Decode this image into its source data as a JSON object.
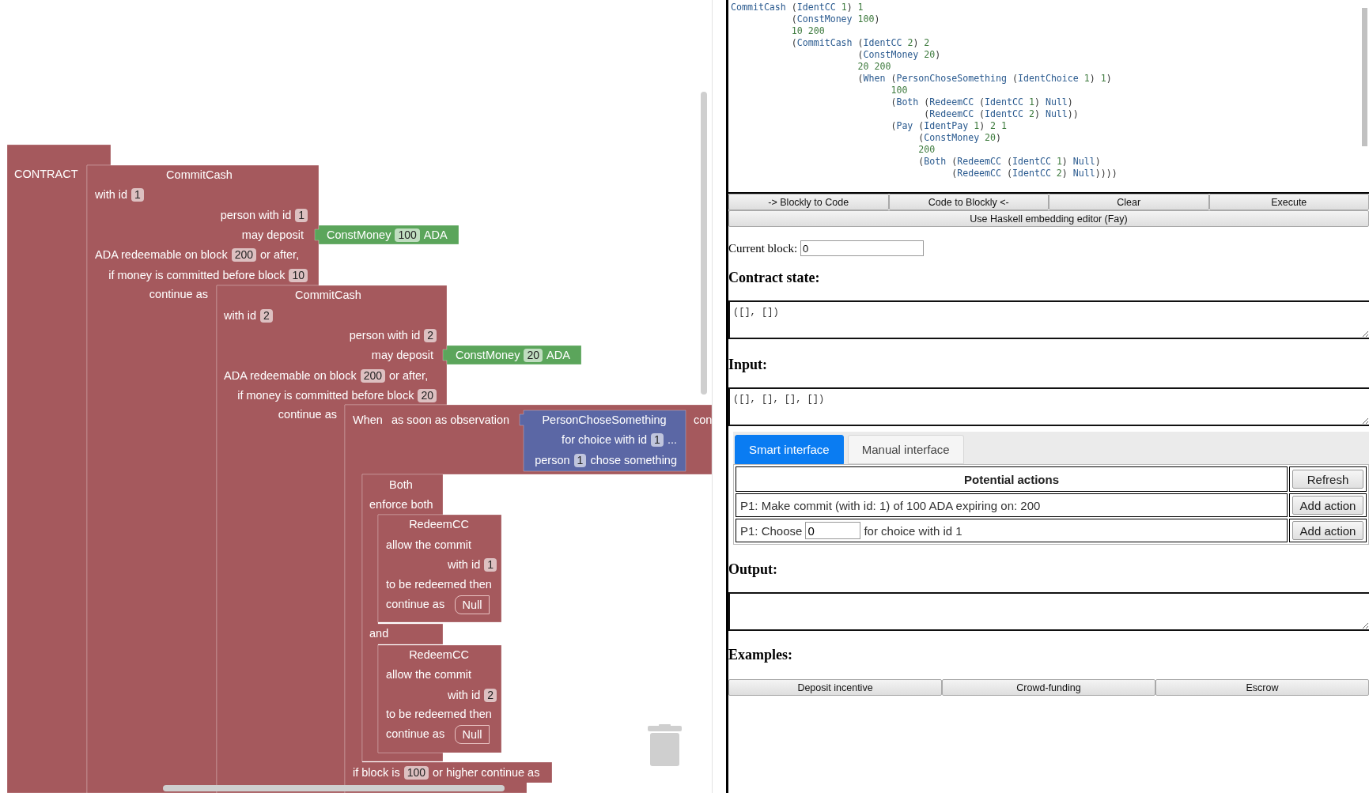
{
  "workspace": {
    "blocks": [
      {
        "kind": "contract",
        "lines": [
          [
            "CONTRACT"
          ]
        ]
      },
      {
        "kind": "statement",
        "lines": [
          [
            "CommitCash"
          ],
          [
            "with id",
            {
              "field": "1"
            }
          ],
          [
            "person with id",
            {
              "field": "1"
            }
          ],
          [
            "may deposit"
          ],
          [
            "ADA redeemable on block",
            {
              "field": "200"
            },
            "or after,"
          ],
          [
            "if money is committed before block",
            {
              "field": "10"
            }
          ],
          [
            "continue as"
          ]
        ]
      },
      {
        "kind": "value",
        "lines": [
          [
            "ConstMoney",
            {
              "field": "100"
            },
            "ADA"
          ]
        ]
      },
      {
        "kind": "statement",
        "lines": [
          [
            "CommitCash"
          ],
          [
            "with id",
            {
              "field": "2"
            }
          ],
          [
            "person with id",
            {
              "field": "2"
            }
          ],
          [
            "may deposit"
          ],
          [
            "ADA redeemable on block",
            {
              "field": "200"
            },
            "or after,"
          ],
          [
            "if money is committed before block",
            {
              "field": "20"
            }
          ],
          [
            "continue as"
          ]
        ]
      },
      {
        "kind": "value",
        "lines": [
          [
            "ConstMoney",
            {
              "field": "20"
            },
            "ADA"
          ]
        ]
      },
      {
        "kind": "statement",
        "lines": [
          [
            "When"
          ],
          [
            "as soon as observation"
          ],
          [
            "con"
          ],
          [
            "if block is",
            {
              "field": "100"
            },
            "or higher continue as"
          ]
        ]
      },
      {
        "kind": "observation",
        "lines": [
          [
            "PersonChoseSomething"
          ],
          [
            "for choice with id",
            {
              "field": "1"
            },
            "..."
          ],
          [
            "person",
            {
              "field": "1"
            },
            "chose something"
          ]
        ]
      },
      {
        "kind": "statement",
        "lines": [
          [
            "Both"
          ],
          [
            "enforce both"
          ],
          [
            "and"
          ]
        ]
      },
      {
        "kind": "statement",
        "lines": [
          [
            "RedeemCC"
          ],
          [
            "allow the commit"
          ],
          [
            "with id",
            {
              "field": "1"
            }
          ],
          [
            "to be redeemed then"
          ],
          [
            "continue as"
          ]
        ]
      },
      {
        "kind": "terminal",
        "lines": [
          [
            "Null"
          ]
        ]
      },
      {
        "kind": "statement",
        "lines": [
          [
            "RedeemCC"
          ],
          [
            "allow the commit"
          ],
          [
            "with id",
            {
              "field": "2"
            }
          ],
          [
            "to be redeemed then"
          ],
          [
            "continue as"
          ]
        ]
      },
      {
        "kind": "terminal",
        "lines": [
          [
            "Null"
          ]
        ]
      }
    ]
  },
  "code": {
    "lines": [
      "CommitCash (IdentCC 1) 1",
      "           (ConstMoney 100)",
      "           10 200",
      "           (CommitCash (IdentCC 2) 2",
      "                       (ConstMoney 20)",
      "                       20 200",
      "                       (When (PersonChoseSomething (IdentChoice 1) 1)",
      "                             100",
      "                             (Both (RedeemCC (IdentCC 1) Null)",
      "                                   (RedeemCC (IdentCC 2) Null))",
      "                             (Pay (IdentPay 1) 2 1",
      "                                  (ConstMoney 20)",
      "                                  200",
      "                                  (Both (RedeemCC (IdentCC 1) Null)",
      "                                        (RedeemCC (IdentCC 2) Null))))"
    ]
  },
  "code_buttons": [
    "-> Blockly to Code",
    "Code to Blockly <-",
    "Clear",
    "Execute"
  ],
  "haskell_button": "Use Haskell embedding editor (Fay)",
  "current_block": {
    "label": "Current block:",
    "value": "0"
  },
  "contract_state": {
    "heading": "Contract state:",
    "value": "([], [])"
  },
  "input": {
    "heading": "Input:",
    "value": "([], [], [], [])"
  },
  "tabs": [
    {
      "label": "Smart interface",
      "selected": true
    },
    {
      "label": "Manual interface",
      "selected": false
    }
  ],
  "actions": {
    "heading": "Potential actions",
    "refresh": "Refresh",
    "rows": [
      {
        "kind": "text",
        "text": "P1: Make commit (with id: 1) of 100 ADA expiring on: 200",
        "button": "Add action"
      },
      {
        "kind": "choice",
        "prefix": "P1: Choose",
        "value": "0",
        "suffix": "for choice with id 1",
        "button": "Add action"
      }
    ]
  },
  "output": {
    "heading": "Output:"
  },
  "examples": {
    "heading": "Examples:",
    "buttons": [
      "Deposit incentive",
      "Crowd-funding",
      "Escrow"
    ]
  }
}
